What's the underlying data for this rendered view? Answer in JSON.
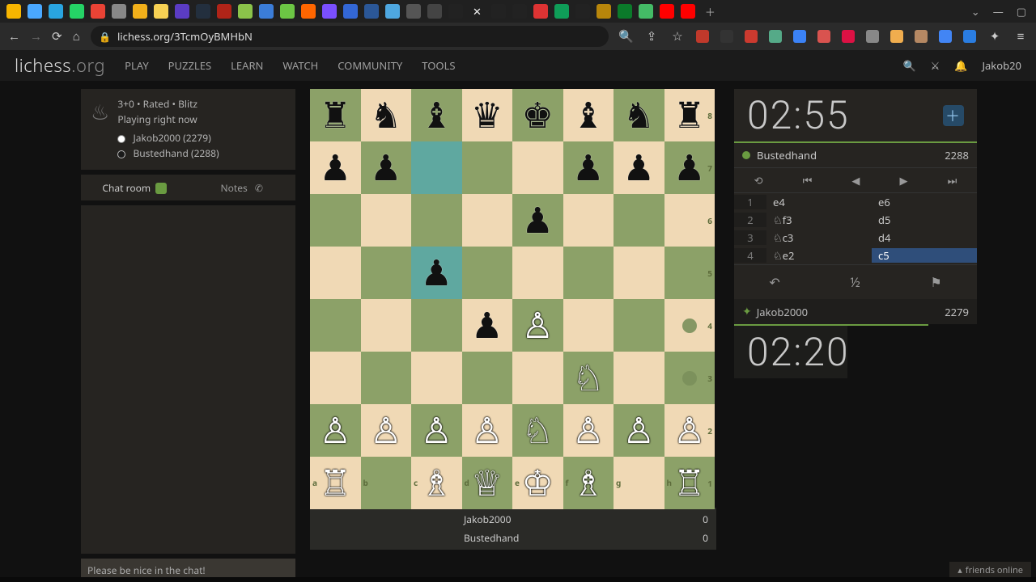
{
  "browser": {
    "url": "lichess.org/3TcmOyBMHbN",
    "controls": {
      "minimize": "—",
      "maximize": "▢",
      "dropdown": "⌄"
    }
  },
  "site": {
    "logo_main": "lichess",
    "logo_suffix": ".org",
    "nav": [
      "PLAY",
      "PUZZLES",
      "LEARN",
      "WATCH",
      "COMMUNITY",
      "TOOLS"
    ],
    "username": "Jakob20"
  },
  "game": {
    "mode_line": "3+0 • Rated • Blitz",
    "status_line": "Playing right now",
    "white": {
      "name": "Jakob2000",
      "rating": "2279"
    },
    "black": {
      "name": "Bustedhand",
      "rating": "2288"
    }
  },
  "chat": {
    "tab_chat": "Chat room",
    "tab_notes": "Notes",
    "placeholder": "Please be nice in the chat!"
  },
  "clocks": {
    "top": "02:55",
    "bottom": "02:20"
  },
  "opponent": {
    "name": "Bustedhand",
    "rating": "2288"
  },
  "me": {
    "name": "Jakob2000",
    "rating": "2279"
  },
  "moves": [
    {
      "n": "1",
      "w": "e4",
      "b": "e6"
    },
    {
      "n": "2",
      "w": "♘f3",
      "b": "d5"
    },
    {
      "n": "3",
      "w": "♘c3",
      "b": "d4"
    },
    {
      "n": "4",
      "w": "♘e2",
      "b": "c5"
    }
  ],
  "actions": {
    "takeback": "↶",
    "draw": "½",
    "resign": "⚑"
  },
  "scores": {
    "p1": {
      "name": "Jakob2000",
      "val": "0"
    },
    "p2": {
      "name": "Bustedhand",
      "val": "0"
    }
  },
  "friends": {
    "label": "friends online"
  },
  "chart_data": {
    "type": "table",
    "title": "Chess position after 4...c5 (White to move)",
    "fen": "rnbqkbnr/pp3ppp/4p3/2p5/3pP3/5N2/PPPPNPPP/R1BQKB1R",
    "highlights": [
      "c7",
      "c5"
    ],
    "move_hints": [
      "h4",
      "h3"
    ],
    "pieces": [
      {
        "sq": "a8",
        "p": "r"
      },
      {
        "sq": "b8",
        "p": "n"
      },
      {
        "sq": "c8",
        "p": "b"
      },
      {
        "sq": "d8",
        "p": "q"
      },
      {
        "sq": "e8",
        "p": "k"
      },
      {
        "sq": "f8",
        "p": "b"
      },
      {
        "sq": "g8",
        "p": "n"
      },
      {
        "sq": "h8",
        "p": "r"
      },
      {
        "sq": "a7",
        "p": "p"
      },
      {
        "sq": "b7",
        "p": "p"
      },
      {
        "sq": "f7",
        "p": "p"
      },
      {
        "sq": "g7",
        "p": "p"
      },
      {
        "sq": "h7",
        "p": "p"
      },
      {
        "sq": "e6",
        "p": "p"
      },
      {
        "sq": "c5",
        "p": "p"
      },
      {
        "sq": "d4",
        "p": "p"
      },
      {
        "sq": "e4",
        "p": "P"
      },
      {
        "sq": "f3",
        "p": "N"
      },
      {
        "sq": "a2",
        "p": "P"
      },
      {
        "sq": "b2",
        "p": "P"
      },
      {
        "sq": "c2",
        "p": "P"
      },
      {
        "sq": "d2",
        "p": "P"
      },
      {
        "sq": "e2",
        "p": "N"
      },
      {
        "sq": "f2",
        "p": "P"
      },
      {
        "sq": "g2",
        "p": "P"
      },
      {
        "sq": "h2",
        "p": "P"
      },
      {
        "sq": "a1",
        "p": "R"
      },
      {
        "sq": "c1",
        "p": "B"
      },
      {
        "sq": "d1",
        "p": "Q"
      },
      {
        "sq": "e1",
        "p": "K"
      },
      {
        "sq": "f1",
        "p": "B"
      },
      {
        "sq": "h1",
        "p": "R"
      }
    ]
  }
}
